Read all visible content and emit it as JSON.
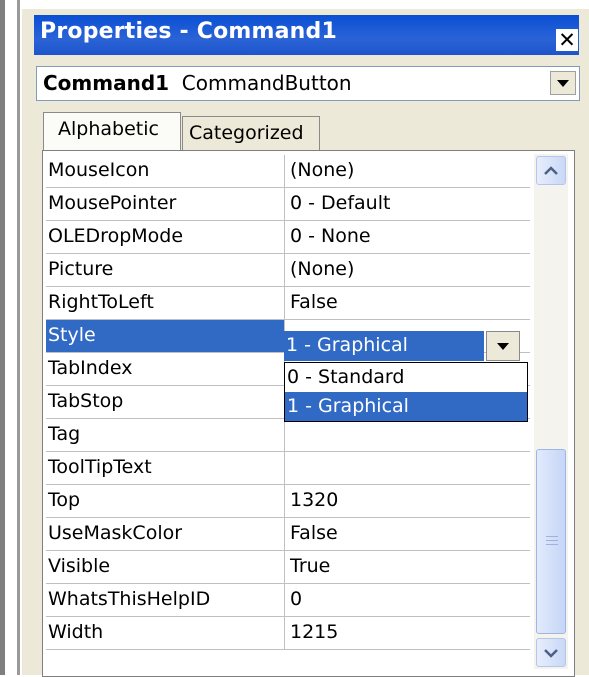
{
  "window": {
    "title": "Properties - Command1",
    "close_glyph": "✕"
  },
  "object_selector": {
    "name": "Command1",
    "type": "CommandButton"
  },
  "tabs": [
    {
      "label": "Alphabetic",
      "active": true
    },
    {
      "label": "Categorized",
      "active": false
    }
  ],
  "properties": [
    {
      "name": "MouseIcon",
      "value": "(None)"
    },
    {
      "name": "MousePointer",
      "value": "0 - Default"
    },
    {
      "name": "OLEDropMode",
      "value": "0 - None"
    },
    {
      "name": "Picture",
      "value": "(None)"
    },
    {
      "name": "RightToLeft",
      "value": "False"
    },
    {
      "name": "Style",
      "value": "1 - Graphical",
      "selected": true
    },
    {
      "name": "TabIndex",
      "value": ""
    },
    {
      "name": "TabStop",
      "value": ""
    },
    {
      "name": "Tag",
      "value": ""
    },
    {
      "name": "ToolTipText",
      "value": ""
    },
    {
      "name": "Top",
      "value": "1320"
    },
    {
      "name": "UseMaskColor",
      "value": "False"
    },
    {
      "name": "Visible",
      "value": "True"
    },
    {
      "name": "WhatsThisHelpID",
      "value": "0"
    },
    {
      "name": "Width",
      "value": "1215"
    }
  ],
  "style_dropdown": {
    "current": "1 - Graphical",
    "options": [
      "0 - Standard",
      "1 - Graphical"
    ],
    "highlighted": "1 - Graphical"
  },
  "colors": {
    "selection": "#316ac5",
    "titlebar": "#0a4fd4"
  }
}
